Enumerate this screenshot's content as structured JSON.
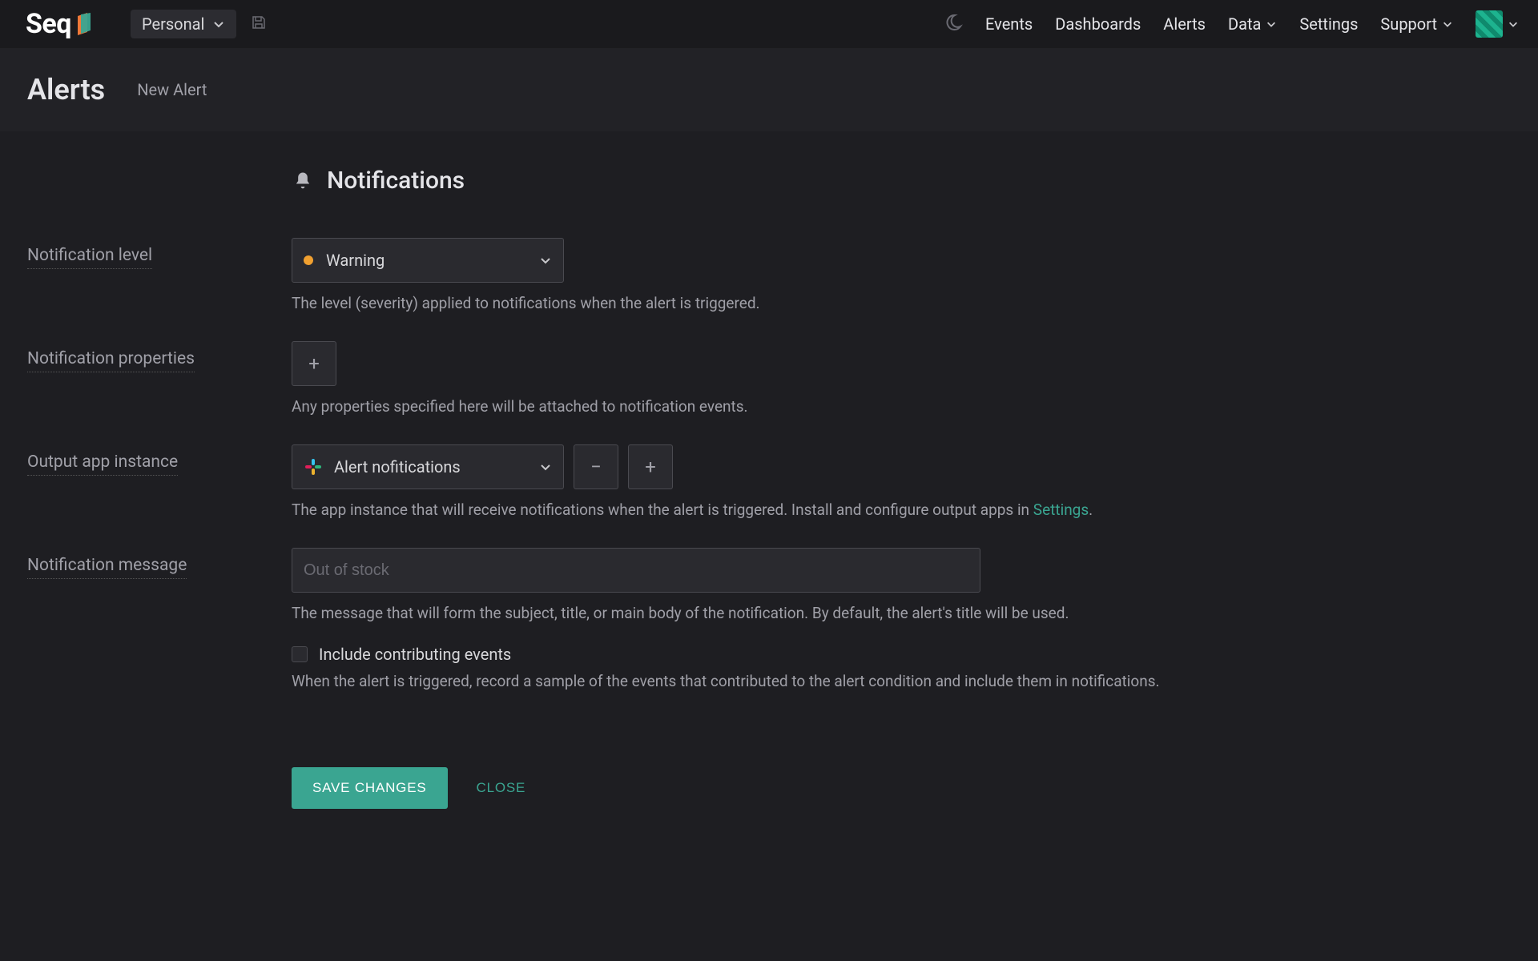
{
  "brand": {
    "name": "Seq"
  },
  "workspace": {
    "selected": "Personal"
  },
  "nav": {
    "events": "Events",
    "dashboards": "Dashboards",
    "alerts": "Alerts",
    "data": "Data",
    "settings": "Settings",
    "support": "Support"
  },
  "page": {
    "title": "Alerts",
    "subtitle": "New Alert"
  },
  "section": {
    "title": "Notifications"
  },
  "fields": {
    "level": {
      "label": "Notification level",
      "value": "Warning",
      "help": "The level (severity) applied to notifications when the alert is triggered."
    },
    "properties": {
      "label": "Notification properties",
      "help": "Any properties specified here will be attached to notification events."
    },
    "output": {
      "label": "Output app instance",
      "value": "Alert nofitications",
      "help_prefix": "The app instance that will receive notifications when the alert is triggered. Install and configure output apps in ",
      "help_link": "Settings",
      "help_suffix": "."
    },
    "message": {
      "label": "Notification message",
      "placeholder": "Out of stock",
      "help": "The message that will form the subject, title, or main body of the notification. By default, the alert's title will be used."
    },
    "include": {
      "label": "Include contributing events",
      "help": "When the alert is triggered, record a sample of the events that contributed to the alert condition and include them in notifications.",
      "checked": false
    }
  },
  "actions": {
    "save": "SAVE CHANGES",
    "close": "CLOSE"
  }
}
